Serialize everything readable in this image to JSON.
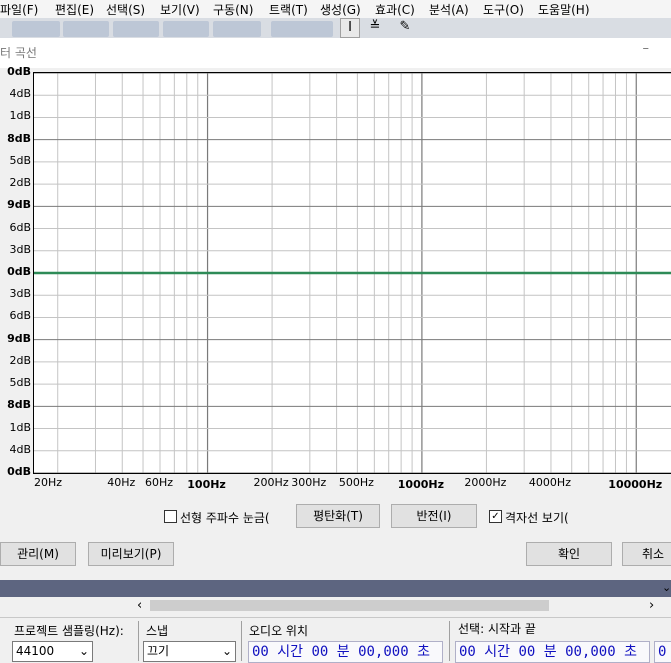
{
  "menu": [
    "파일(F)",
    "편집(E)",
    "선택(S)",
    "보기(V)",
    "구동(N)",
    "트랙(T)",
    "생성(G)",
    "효과(C)",
    "분석(A)",
    "도구(O)",
    "도움말(H)"
  ],
  "tools": [
    "I",
    "≚",
    "✎"
  ],
  "dialog": {
    "title": "터 곡선",
    "minimize": "–"
  },
  "graph": {
    "y_labels": [
      "0dB",
      "4dB",
      "1dB",
      "8dB",
      "5dB",
      "2dB",
      "9dB",
      "6dB",
      "3dB",
      "0dB",
      "3dB",
      "6dB",
      "9dB",
      "2dB",
      "5dB",
      "8dB",
      "1dB",
      "4dB",
      "0dB"
    ],
    "x_labels": [
      "20Hz",
      "40Hz",
      "60Hz",
      "100Hz",
      "200Hz",
      "300Hz",
      "500Hz",
      "1000Hz",
      "2000Hz",
      "4000Hz",
      "10000Hz"
    ],
    "curve_color": "#2e8b57",
    "curve_db": 0,
    "grid": true,
    "x_scale": "log"
  },
  "options": {
    "linear_freq_label": "선형 주파수 눈금(",
    "linear_freq_checked": false,
    "flatten_label": "평탄화(T)",
    "invert_label": "반전(I)",
    "show_grid_label": "격자선 보기(",
    "show_grid_checked": true
  },
  "buttons": {
    "manage": "관리(M)",
    "preview": "미리보기(P)",
    "ok": "확인",
    "cancel": "취소"
  },
  "scroll": {
    "left": "‹",
    "right": "›"
  },
  "selection_toolbar": {
    "rate_label": "프로젝트 샘플링(Hz):",
    "rate_value": "44100",
    "snap_label": "스냅",
    "snap_value": "끄기",
    "audio_pos_label": "오디오 위치",
    "audio_pos_value": "00 시간 00 분 00,000 초",
    "selection_label": "선택: 시작과 끝",
    "selection_start_value": "00 시간 00 분 00,000 초",
    "selection_end_value": "0"
  }
}
